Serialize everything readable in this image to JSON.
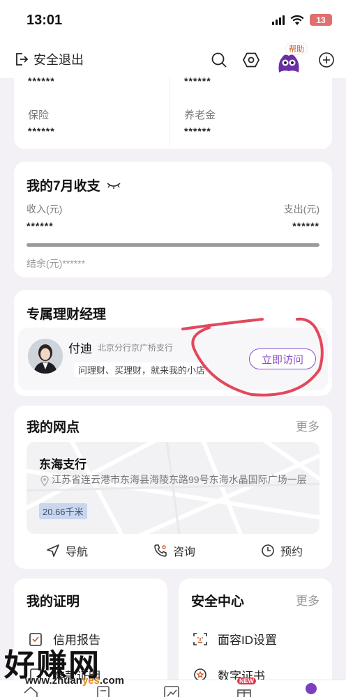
{
  "status_bar": {
    "time": "13:01",
    "battery": "13"
  },
  "top_bar": {
    "logout_label": "安全退出",
    "help_badge": "帮助"
  },
  "assets": {
    "masks": [
      "******",
      "******",
      "******",
      "******"
    ],
    "insurance_label": "保险",
    "pension_label": "养老金"
  },
  "monthly": {
    "title": "我的7月收支",
    "income_label": "收入(元)",
    "income_value": "******",
    "expense_label": "支出(元)",
    "expense_value": "******",
    "balance_label": "结余(元)******"
  },
  "manager": {
    "title": "专属理财经理",
    "name": "付迪",
    "branch": "北京分行京广桥支行",
    "slogan": "问理财、买理财，就来我的小店",
    "visit_label": "立即访问"
  },
  "branch": {
    "title": "我的网点",
    "more_label": "更多",
    "name": "东海支行",
    "address": "江苏省连云港市东海县海陵东路99号东海水晶国际广场一层",
    "distance": "20.66千米",
    "actions": {
      "navigate": "导航",
      "consult": "咨询",
      "reserve": "预约"
    }
  },
  "certificates": {
    "title": "我的证明",
    "items": [
      "信用报告",
      "存款证明"
    ]
  },
  "security": {
    "title": "安全中心",
    "more_label": "更多",
    "items": [
      "面容ID设置",
      "数字证书"
    ]
  },
  "tab_bar": {
    "new_badge": "NEW"
  },
  "watermark": {
    "text": "好赚网",
    "url_prefix": "www.zhuan",
    "url_accent": "yes",
    "url_suffix": ".com"
  },
  "colors": {
    "accent": "#8a4fc7",
    "background": "#f3f1f6",
    "annotation": "#e0344a"
  }
}
